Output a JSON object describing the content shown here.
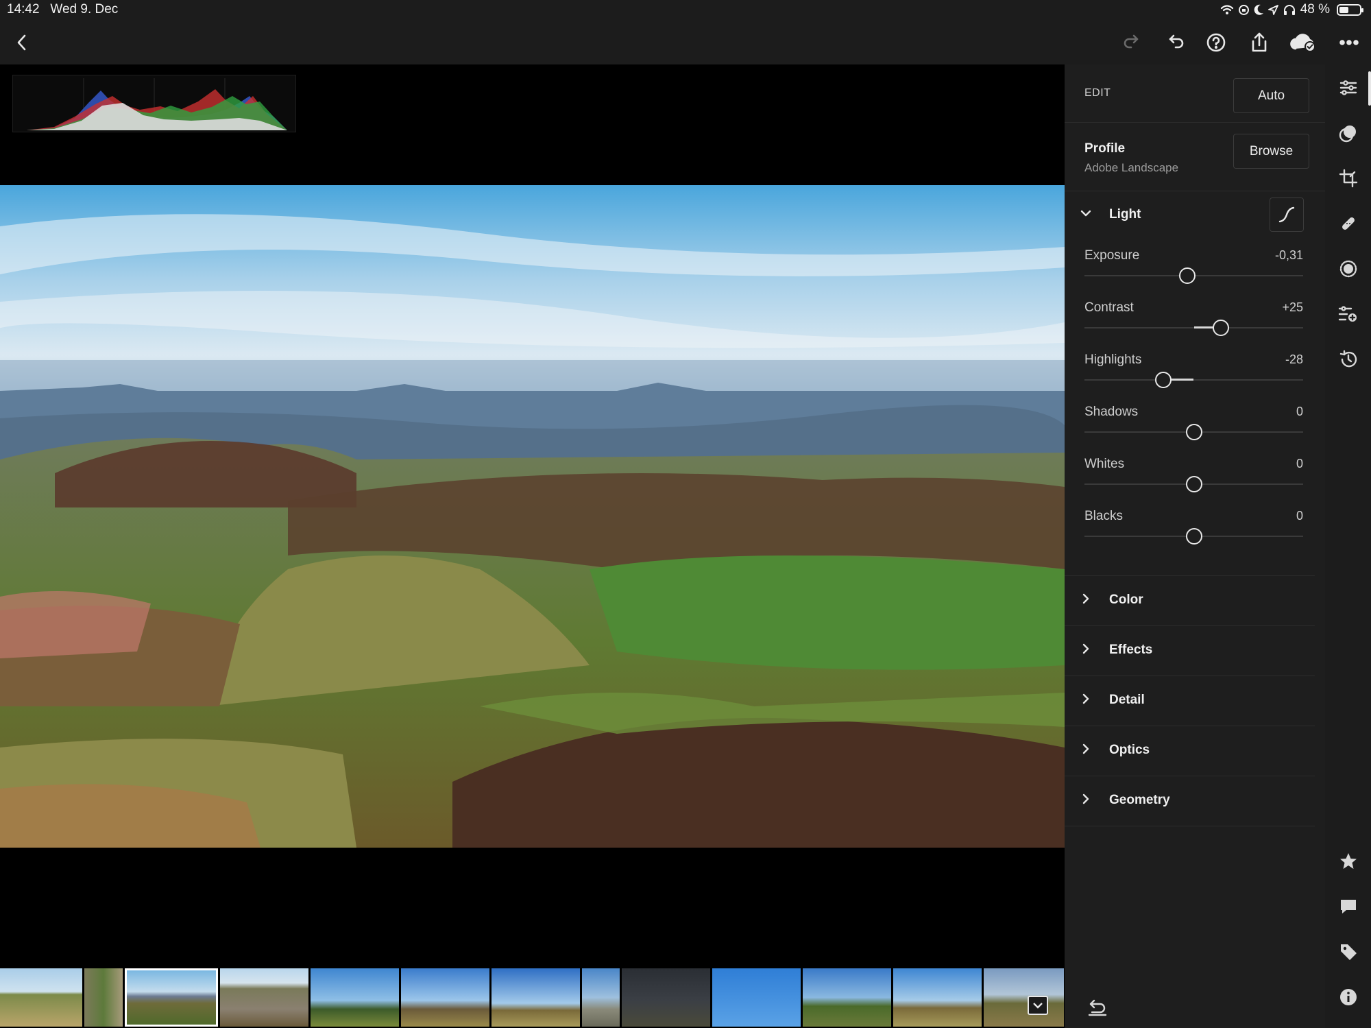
{
  "status_bar": {
    "time": "14:42",
    "date": "Wed 9. Dec",
    "battery_percent": "48 %",
    "battery_level": 0.48
  },
  "top_toolbar": {
    "back_icon": "chevron-left-icon",
    "icons": [
      "redo-icon",
      "undo-icon",
      "help-icon",
      "share-icon",
      "cloud-synced-icon",
      "more-icon"
    ]
  },
  "edit_panel": {
    "header": "EDIT",
    "auto_button": "Auto",
    "profile": {
      "title": "Profile",
      "value": "Adobe Landscape",
      "browse_button": "Browse"
    },
    "light": {
      "title": "Light",
      "expanded": true,
      "sliders": [
        {
          "label": "Exposure",
          "value": "-0,31",
          "numeric": -0.31,
          "min": -5,
          "max": 5
        },
        {
          "label": "Contrast",
          "value": "+25",
          "numeric": 25,
          "min": -100,
          "max": 100
        },
        {
          "label": "Highlights",
          "value": "-28",
          "numeric": -28,
          "min": -100,
          "max": 100
        },
        {
          "label": "Shadows",
          "value": "0",
          "numeric": 0,
          "min": -100,
          "max": 100
        },
        {
          "label": "Whites",
          "value": "0",
          "numeric": 0,
          "min": -100,
          "max": 100
        },
        {
          "label": "Blacks",
          "value": "0",
          "numeric": 0,
          "min": -100,
          "max": 100
        }
      ]
    },
    "sections": [
      "Color",
      "Effects",
      "Detail",
      "Optics",
      "Geometry"
    ]
  },
  "tool_rail": {
    "icons": [
      "edit-sliders-icon",
      "selective-masking-icon",
      "crop-icon",
      "healing-icon",
      "vignette-icon",
      "presets-icon",
      "versions-icon",
      "rating-star-icon",
      "comment-icon",
      "tag-icon",
      "info-icon"
    ]
  },
  "filmstrip": {
    "count": 12,
    "selected_index": 2
  },
  "colors": {
    "accent": "#ffffff",
    "panel_bg": "#1e1e1e",
    "toolbar_bg": "#1c1c1c"
  }
}
